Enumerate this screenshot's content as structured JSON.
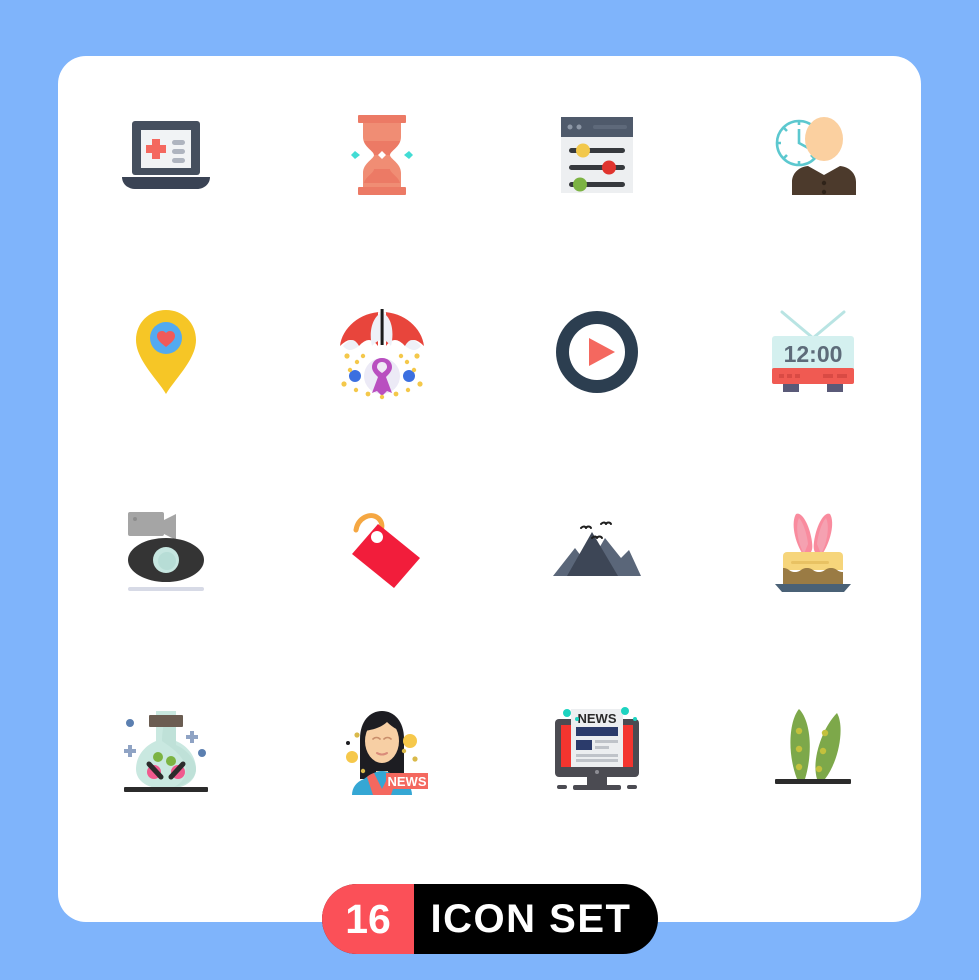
{
  "canvas": {
    "background_color": "#7fb4fb",
    "card_color": "#ffffff"
  },
  "badge": {
    "count": "16",
    "label": "ICON SET",
    "count_bg": "#fb5058",
    "label_bg": "#000000",
    "text_color": "#ffffff"
  },
  "icons": [
    {
      "id": "laptop-medical",
      "name": "medical-laptop-icon",
      "row": 1,
      "col": 1,
      "colors": [
        "#454f5e",
        "#f1f3f5",
        "#f4685f",
        "#aeb4bf"
      ]
    },
    {
      "id": "hourglass",
      "name": "hourglass-icon",
      "row": 1,
      "col": 2,
      "colors": [
        "#ec7a65",
        "#f08d74",
        "#42dcd4"
      ]
    },
    {
      "id": "settings-sliders",
      "name": "settings-sliders-icon",
      "row": 1,
      "col": 3,
      "colors": [
        "#4f5a6b",
        "#edeff1",
        "#36393d",
        "#f2c84b",
        "#e0342e",
        "#7cb342"
      ]
    },
    {
      "id": "clock-employee",
      "name": "time-employee-icon",
      "row": 1,
      "col": 4,
      "colors": [
        "#5cc8cf",
        "#fbd0a0",
        "#4c3a2c"
      ]
    },
    {
      "id": "location-heart",
      "name": "favorite-location-pin-icon",
      "row": 2,
      "col": 1,
      "colors": [
        "#f6c626",
        "#53aaf0",
        "#f05a5a"
      ]
    },
    {
      "id": "umbrella-ribbon",
      "name": "cancer-awareness-umbrella-icon",
      "row": 2,
      "col": 2,
      "colors": [
        "#e8453c",
        "#eef0f7",
        "#b94fc0",
        "#3b6fe0",
        "#f4c84a"
      ]
    },
    {
      "id": "play-button",
      "name": "play-button-icon",
      "row": 2,
      "col": 3,
      "colors": [
        "#2c3e50",
        "#f4685f"
      ]
    },
    {
      "id": "tv-clock",
      "name": "television-time-icon",
      "row": 2,
      "col": 4,
      "colors": [
        "#d4f0ef",
        "#f05a52",
        "#5a5a78",
        "#5d6b79"
      ],
      "display": "12:00"
    },
    {
      "id": "camera-record",
      "name": "video-camera-record-icon",
      "row": 3,
      "col": 1,
      "colors": [
        "#a5a5a5",
        "#343434",
        "#c6e6e0",
        "#d7dae6"
      ]
    },
    {
      "id": "price-tag",
      "name": "price-tag-icon",
      "row": 3,
      "col": 2,
      "colors": [
        "#f21d3b",
        "#f5a742"
      ]
    },
    {
      "id": "mountains-birds",
      "name": "mountains-icon",
      "row": 3,
      "col": 3,
      "colors": [
        "#3d4656",
        "#5a6679",
        "#1e1e1e"
      ]
    },
    {
      "id": "easter-cake",
      "name": "easter-bunny-cake-icon",
      "row": 3,
      "col": 4,
      "colors": [
        "#f98b9e",
        "#f6d57b",
        "#9a7b44",
        "#4a6176"
      ]
    },
    {
      "id": "chemistry-flask",
      "name": "chemistry-flask-icon",
      "row": 4,
      "col": 1,
      "colors": [
        "#c9e8e0",
        "#6b5d52",
        "#2b2b2b",
        "#7cb342",
        "#f05a8e",
        "#5b7fb0"
      ]
    },
    {
      "id": "news-anchor",
      "name": "news-anchor-woman-icon",
      "row": 4,
      "col": 2,
      "colors": [
        "#1d1d22",
        "#f7cfa4",
        "#35a7d4",
        "#f4685f"
      ],
      "display": "NEWS"
    },
    {
      "id": "news-monitor",
      "name": "news-monitor-icon",
      "row": 4,
      "col": 3,
      "colors": [
        "#4b4b52",
        "#f4352f",
        "#eceef0",
        "#2b3b6b",
        "#1dd3c0"
      ],
      "display": "NEWS"
    },
    {
      "id": "leaves-plant",
      "name": "leaves-plant-icon",
      "row": 4,
      "col": 4,
      "colors": [
        "#7da84a",
        "#c3c13d",
        "#2b2b2b"
      ]
    }
  ]
}
